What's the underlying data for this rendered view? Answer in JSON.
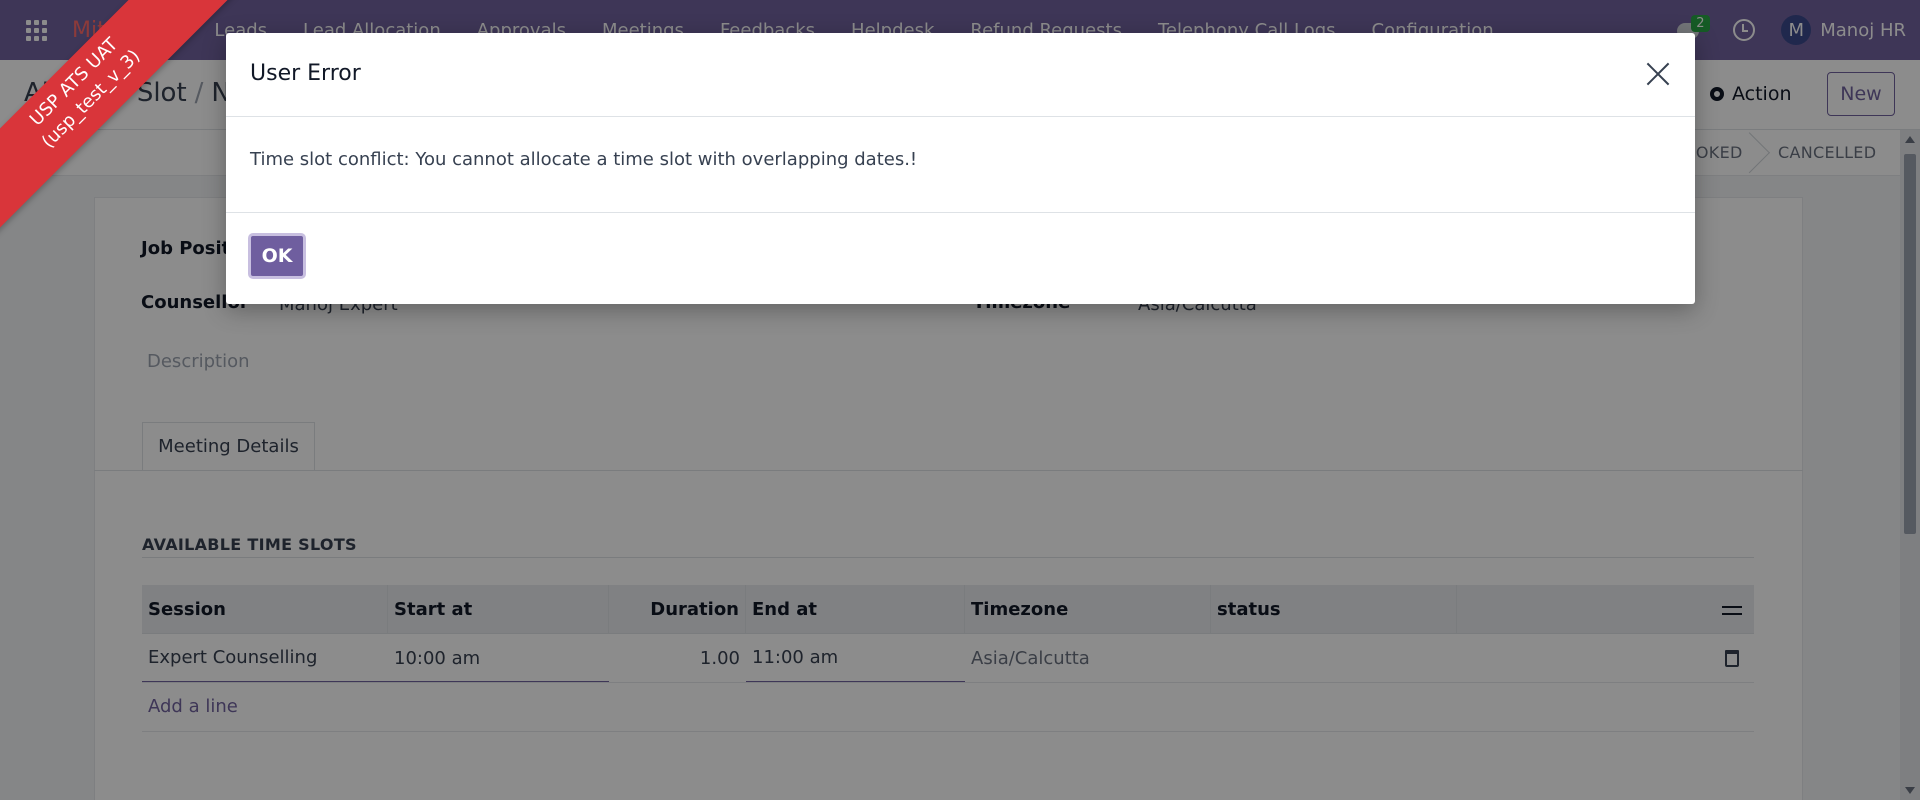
{
  "navbar": {
    "brand": "Mitas ATS",
    "menu": [
      "Leads",
      "Lead Allocation",
      "Approvals",
      "Meetings",
      "Feedbacks",
      "Helpdesk",
      "Refund Requests",
      "Telephony Call Logs",
      "Configuration"
    ],
    "chat_count": "2",
    "user_initial": "M",
    "user_name": "Manoj HR"
  },
  "control_panel": {
    "breadcrumb_parent": "Allocate Slot",
    "breadcrumb_current": "New",
    "action_label": "Action",
    "new_label": "New"
  },
  "status_bar": {
    "stages": [
      "BOOKED",
      "CANCELLED"
    ]
  },
  "form": {
    "job_position_label": "Job Position",
    "counsellor_label": "Counsellor",
    "counsellor_value": "Manoj Expert",
    "timezone_label": "Timezone",
    "timezone_value": "Asia/Calcutta",
    "description_placeholder": "Description",
    "tab_label": "Meeting Details",
    "section_title": "AVAILABLE TIME SLOTS",
    "table": {
      "columns": [
        "Session",
        "Start at",
        "Duration",
        "End at",
        "Timezone",
        "status"
      ],
      "rows": [
        {
          "session": "Expert Counselling",
          "start_at": "10:00 am",
          "duration": "1.00",
          "end_at": "11:00 am",
          "timezone": "Asia/Calcutta",
          "status": ""
        }
      ],
      "add_line": "Add a line"
    }
  },
  "modal": {
    "title": "User Error",
    "message": "Time slot conflict: You cannot allocate a time slot with overlapping dates.!",
    "ok_label": "OK"
  },
  "ribbon": {
    "line1": "USP ATS UAT",
    "line2": "(usp_test_v_3)"
  },
  "colors": {
    "brand": "#71639e",
    "ribbon": "#d9353a",
    "badge": "#28a745"
  }
}
